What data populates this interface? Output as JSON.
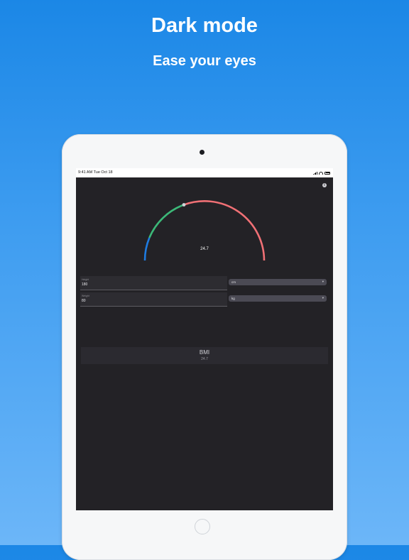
{
  "promo": {
    "title": "Dark mode",
    "subtitle": "Ease your eyes"
  },
  "status_bar": {
    "time": "9:41 AM  Tue Oct 18"
  },
  "gauge": {
    "value": "24.7",
    "colors": {
      "blue": "#1e7be0",
      "green": "#3cb878",
      "red": "#f07075"
    }
  },
  "height": {
    "label": "Height",
    "value": "180",
    "unit": "cm"
  },
  "weight": {
    "label": "Weight",
    "value": "80",
    "unit": "kg"
  },
  "result": {
    "title": "BMI",
    "value": "24.7"
  },
  "icons": {
    "info": "info-icon",
    "caret": "chevron-down-icon"
  }
}
